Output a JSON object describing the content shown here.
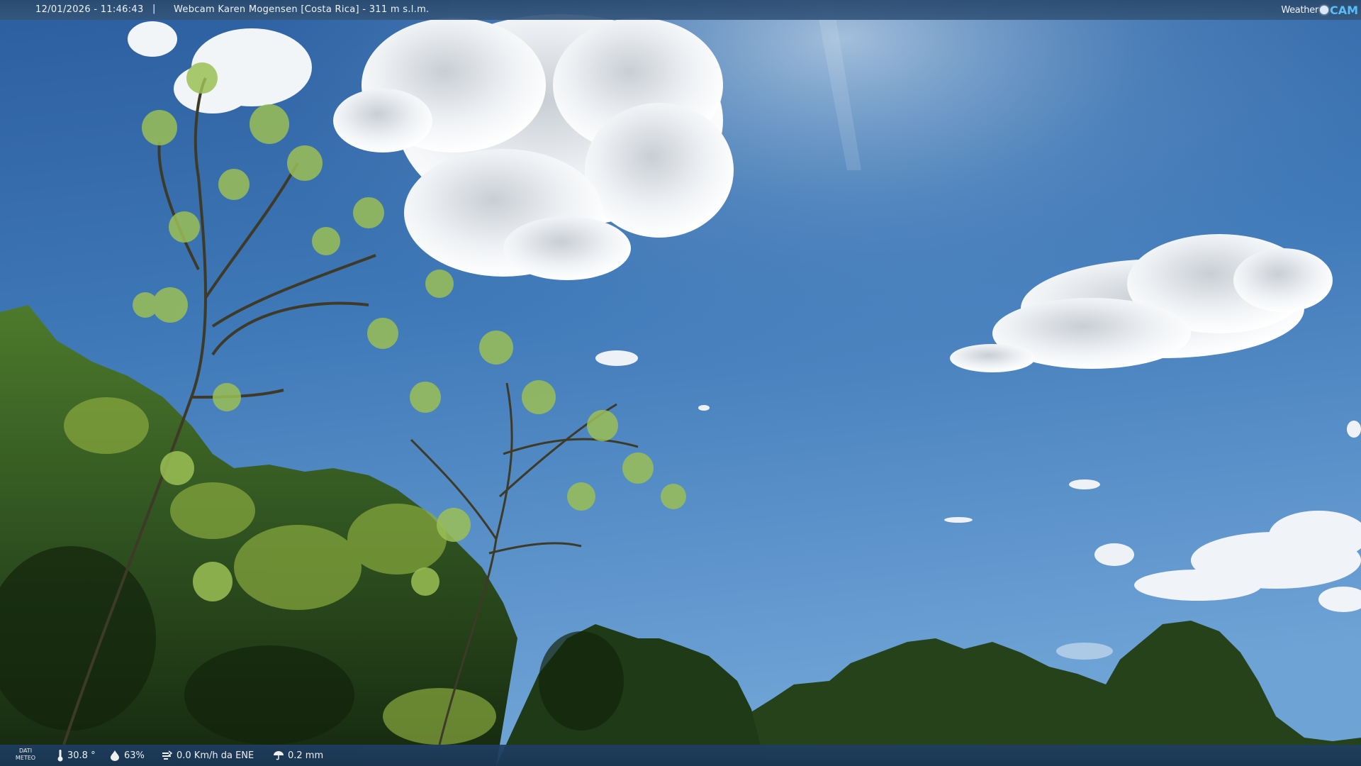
{
  "header": {
    "datetime": "12/01/2026 - 11:46:43",
    "separator": "|",
    "title": "Webcam Karen Mogensen [Costa Rica]  -  311 m s.l.m."
  },
  "logo": {
    "weather": "Weather",
    "cam": "CAM"
  },
  "footer": {
    "meteo_label_line1": "DATI",
    "meteo_label_line2": "METEO",
    "temperature": "30.8 °",
    "humidity": "63%",
    "wind": "0.0 Km/h da ENE",
    "rain": "0.2 mm"
  },
  "icons": {
    "temperature": "thermometer-icon",
    "humidity": "humidity-drop-icon",
    "wind": "wind-icon",
    "rain": "rain-icon"
  },
  "colors": {
    "sky_top": "#2f62a5",
    "sky_bottom": "#5b93cc",
    "foliage_dark": "#1c3515",
    "foliage_light": "#7a9a3a",
    "bar": "#24476f"
  }
}
